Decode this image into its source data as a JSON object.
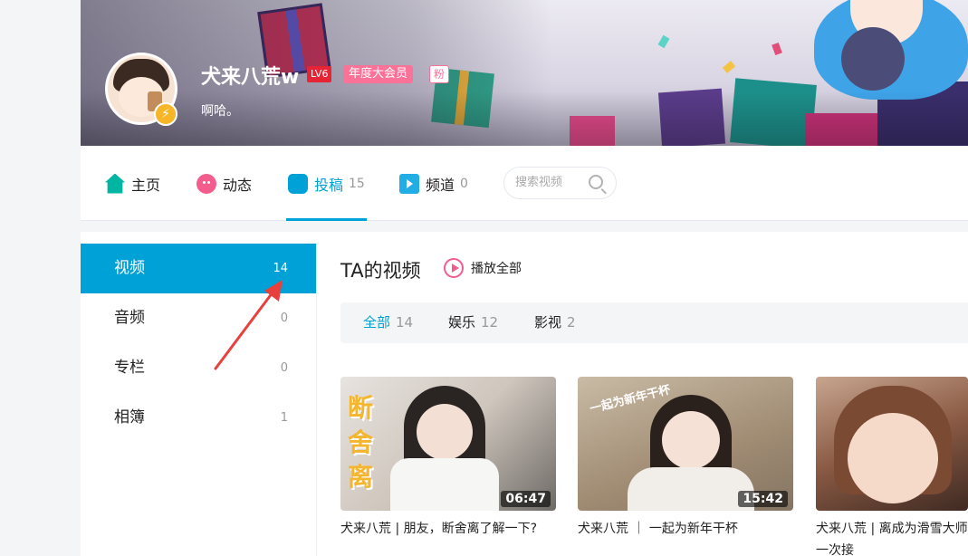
{
  "profile": {
    "username": "犬来八荒w",
    "level": "LV6",
    "vip_badge": "年度大会员",
    "fan_badge": "粉",
    "signature": "啊哈。"
  },
  "nav": {
    "items": [
      {
        "label": "主页",
        "count": "",
        "icon": "home-icon"
      },
      {
        "label": "动态",
        "count": "",
        "icon": "dynamic-icon"
      },
      {
        "label": "投稿",
        "count": "15",
        "icon": "upload-icon",
        "active": true
      },
      {
        "label": "频道",
        "count": "0",
        "icon": "channel-icon"
      }
    ],
    "search_placeholder": "搜索视频"
  },
  "sidebar": {
    "items": [
      {
        "label": "视频",
        "count": "14",
        "active": true
      },
      {
        "label": "音频",
        "count": "0"
      },
      {
        "label": "专栏",
        "count": "0"
      },
      {
        "label": "相簿",
        "count": "1"
      }
    ]
  },
  "section": {
    "title": "TA的视频",
    "play_all": "播放全部"
  },
  "filters": [
    {
      "label": "全部",
      "count": "14",
      "active": true
    },
    {
      "label": "娱乐",
      "count": "12"
    },
    {
      "label": "影视",
      "count": "2"
    }
  ],
  "videos": [
    {
      "title": "犬来八荒 | 朋友，断舍离了解一下?",
      "duration": "06:47",
      "overlay": "断舍离"
    },
    {
      "title": "犬来八荒 ｜ 一起为新年干杯",
      "duration": "15:42",
      "overlay": "一起为新年干杯"
    },
    {
      "title": "犬来八荒 | 离成为滑雪大师一次接",
      "duration": ""
    }
  ],
  "colors": {
    "accent": "#00a1d6",
    "pink": "#fb7299",
    "level_red": "#e52435",
    "arrow": "#e8403c"
  }
}
